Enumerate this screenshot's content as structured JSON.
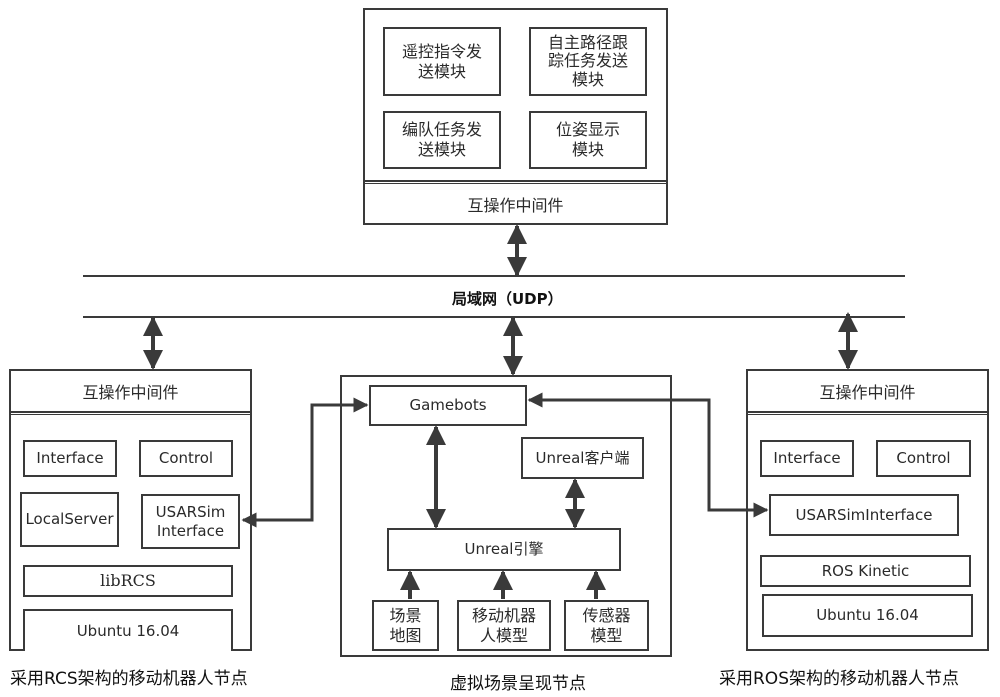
{
  "network": {
    "label": "局域网（UDP）"
  },
  "control_node": {
    "modules": [
      "遥控指令发\n送模块",
      "自主路径跟\n踪任务发送\n模块",
      "编队任务发\n送模块",
      "位姿显示\n模块"
    ],
    "middleware": "互操作中间件"
  },
  "rcs_node": {
    "middleware": "互操作中间件",
    "modules": {
      "interface": "Interface",
      "control": "Control",
      "local_server": "LocalServer",
      "usarsim_interface": "USARSim\nInterface",
      "lib": "libRCS",
      "os": "Ubuntu 16.04"
    },
    "caption": "采用RCS架构的移动机器人节点"
  },
  "sim_node": {
    "gamebots": "Gamebots",
    "client": "Unreal客户端",
    "engine": "Unreal引擎",
    "inputs": [
      "场景\n地图",
      "移动机器\n人模型",
      "传感器\n模型"
    ],
    "caption": "虚拟场景呈现节点"
  },
  "ros_node": {
    "middleware": "互操作中间件",
    "modules": {
      "interface": "Interface",
      "control": "Control",
      "usarsim_interface": "USARSimInterface",
      "ros": "ROS Kinetic",
      "os": "Ubuntu 16.04"
    },
    "caption": "采用ROS架构的移动机器人节点"
  }
}
